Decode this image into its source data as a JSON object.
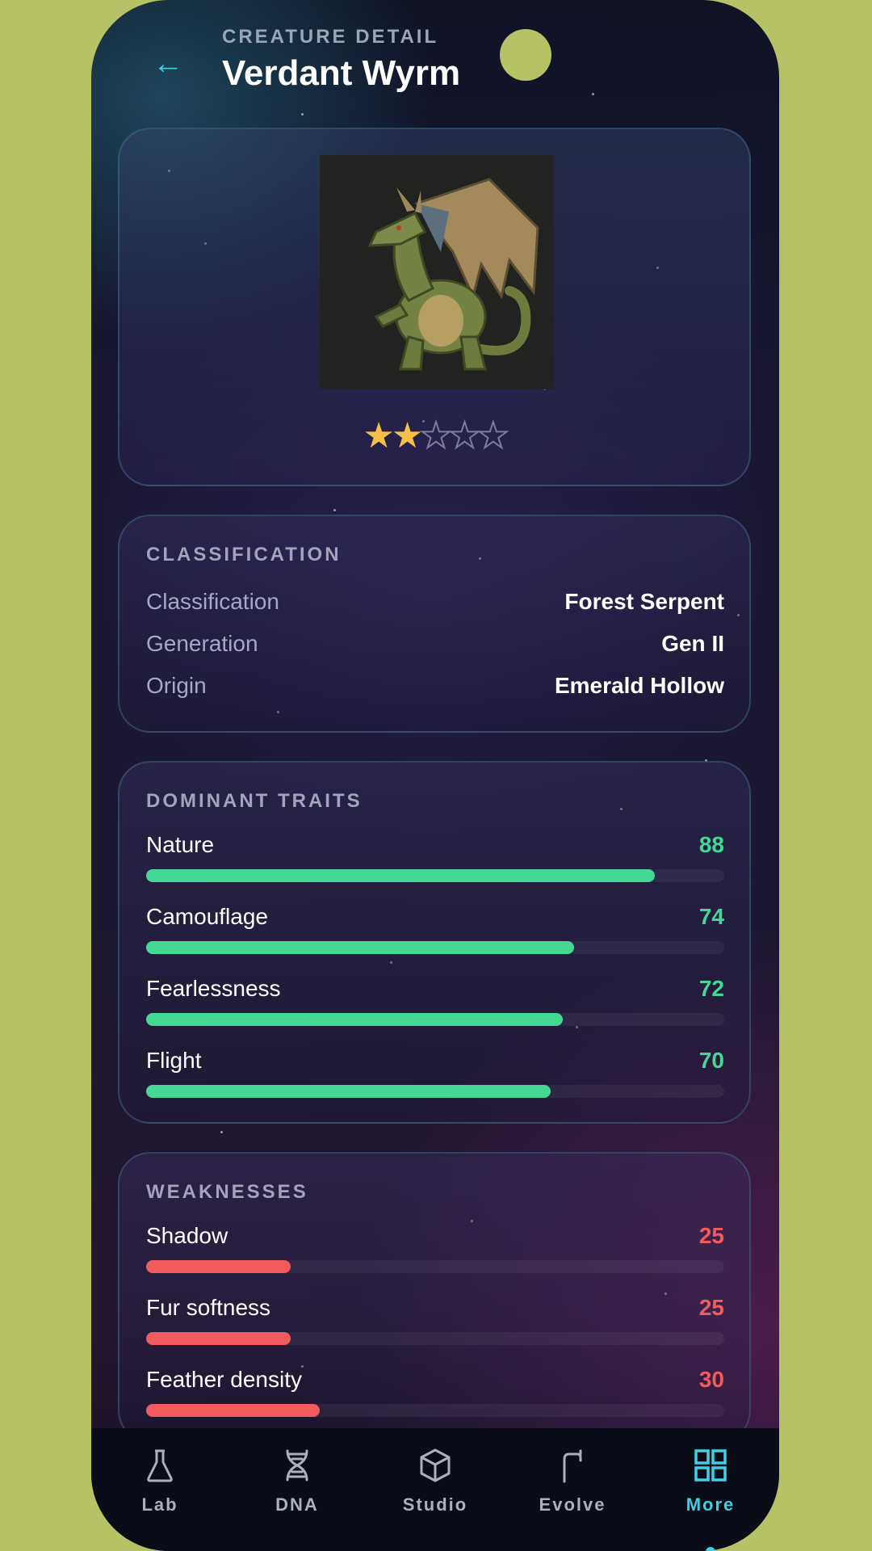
{
  "header": {
    "back_icon": "arrow-left-icon",
    "eyebrow": "CREATURE DETAIL",
    "title": "Verdant Wyrm"
  },
  "creature": {
    "image": "green-dragon-illustration",
    "rating": 2,
    "rating_max": 5
  },
  "classification": {
    "section_title": "CLASSIFICATION",
    "rows": [
      {
        "label": "Classification",
        "value": "Forest Serpent"
      },
      {
        "label": "Generation",
        "value": "Gen II"
      },
      {
        "label": "Origin",
        "value": "Emerald Hollow"
      }
    ]
  },
  "traits": {
    "section_title": "DOMINANT TRAITS",
    "color": "#45d894",
    "items": [
      {
        "label": "Nature",
        "value": 88
      },
      {
        "label": "Camouflage",
        "value": 74
      },
      {
        "label": "Fearlessness",
        "value": 72
      },
      {
        "label": "Flight",
        "value": 70
      }
    ]
  },
  "weaknesses": {
    "section_title": "WEAKNESSES",
    "color": "#f25b5e",
    "items": [
      {
        "label": "Shadow",
        "value": 25
      },
      {
        "label": "Fur softness",
        "value": 25
      },
      {
        "label": "Feather density",
        "value": 30
      }
    ]
  },
  "nav": {
    "active": "More",
    "accent": "#3fd0e4",
    "items": [
      {
        "label": "Lab",
        "icon": "flask-icon"
      },
      {
        "label": "DNA",
        "icon": "dna-icon"
      },
      {
        "label": "Studio",
        "icon": "cube-icon"
      },
      {
        "label": "Evolve",
        "icon": "branch-icon"
      },
      {
        "label": "More",
        "icon": "grid-icon"
      }
    ]
  }
}
